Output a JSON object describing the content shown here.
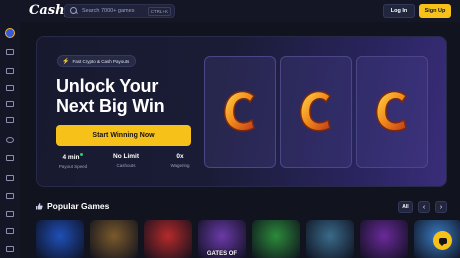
{
  "brand": {
    "logo_text": "Cashy",
    "accent": "#f6c21a"
  },
  "header": {
    "search_placeholder": "Search 7000+ games",
    "search_shortcut": "CTRL+K",
    "login_label": "Log In",
    "signup_label": "Sign Up"
  },
  "sidebar": {
    "items": [
      {
        "icon": "casino-chip-icon"
      },
      {
        "icon": "sports-icon"
      },
      {
        "icon": "slots-icon"
      },
      {
        "icon": "live-casino-icon"
      },
      {
        "icon": "headset-icon"
      },
      {
        "icon": "cards-icon"
      },
      {
        "icon": "clock-icon"
      },
      {
        "icon": "crash-icon"
      },
      {
        "icon": "gift-icon"
      },
      {
        "icon": "promotions-icon"
      },
      {
        "icon": "vip-icon"
      },
      {
        "icon": "news-icon"
      },
      {
        "icon": "support-icon"
      }
    ]
  },
  "hero": {
    "badge": "Fast Crypto & Cash Payouts",
    "headline_line1": "Unlock Your",
    "headline_line2": "Next Big Win",
    "cta_label": "Start Winning Now",
    "reel_symbol": "C",
    "stats": [
      {
        "value": "4 min",
        "label": "Payout Speed"
      },
      {
        "value": "No Limit",
        "label": "Cashouts"
      },
      {
        "value": "0x",
        "label": "Wagering"
      }
    ]
  },
  "popular": {
    "title": "Popular Games",
    "all_label": "All",
    "prev_icon": "chevron-left-icon",
    "next_icon": "chevron-right-icon",
    "games": [
      {
        "name": "",
        "color": "#1f4fb8"
      },
      {
        "name": "",
        "color": "#7a5a2c"
      },
      {
        "name": "",
        "color": "#b52a2a"
      },
      {
        "name": "GATES OF",
        "color": "#6a3aa8"
      },
      {
        "name": "",
        "color": "#2c8a3a"
      },
      {
        "name": "",
        "color": "#3a6a8a"
      },
      {
        "name": "",
        "color": "#6a2a9a"
      },
      {
        "name": "",
        "color": "#3a7ac0"
      }
    ]
  }
}
